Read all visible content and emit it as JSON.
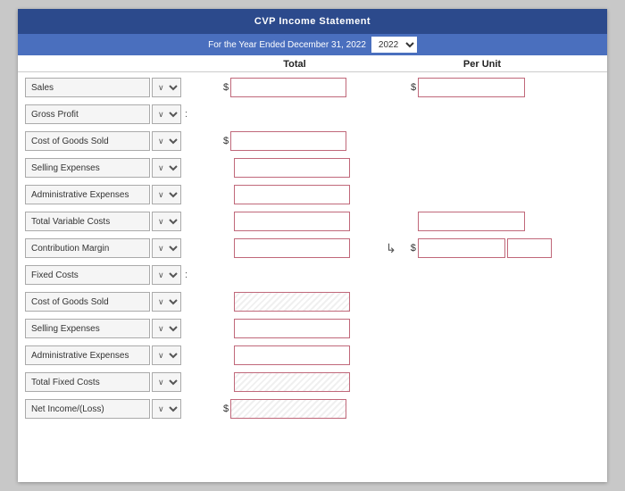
{
  "header": {
    "title": "CVP Income Statement",
    "subheader_label": "For the Year Ended December 31, 2022"
  },
  "columns": {
    "total": "Total",
    "per_unit": "Per Unit"
  },
  "rows": [
    {
      "id": "sales",
      "label": "Sales",
      "has_dropdown": true,
      "has_colon": false,
      "has_dollar_left": false,
      "has_dollar_total": true,
      "has_input_left": false,
      "has_input_total": true,
      "has_input_perunit": true,
      "has_dollar_perunit": true
    },
    {
      "id": "gross-profit",
      "label": "Gross Profit",
      "has_dropdown": true,
      "has_colon": true,
      "has_dollar_left": false,
      "has_dollar_total": false,
      "has_input_left": false,
      "has_input_total": false,
      "has_input_perunit": false,
      "has_dollar_perunit": false
    },
    {
      "id": "cost-of-goods-sold-1",
      "label": "Cost of Goods Sold",
      "has_dropdown": true,
      "has_colon": false,
      "has_dollar_left": true,
      "has_dollar_total": false,
      "has_input_left": true,
      "has_input_total": false,
      "has_input_perunit": false,
      "has_dollar_perunit": false
    },
    {
      "id": "selling-expenses-1",
      "label": "Selling Expenses",
      "has_dropdown": true,
      "has_colon": false,
      "has_dollar_left": false,
      "has_dollar_total": false,
      "has_input_left": true,
      "has_input_total": false,
      "has_input_perunit": false,
      "has_dollar_perunit": false
    },
    {
      "id": "admin-expenses-1",
      "label": "Administrative Expenses",
      "has_dropdown": true,
      "has_colon": false,
      "has_dollar_left": false,
      "has_dollar_total": false,
      "has_input_left": true,
      "has_input_total": false,
      "has_input_perunit": false,
      "has_dollar_perunit": false
    },
    {
      "id": "total-variable-costs",
      "label": "Total Variable Costs",
      "has_dropdown": true,
      "has_colon": false,
      "has_dollar_left": false,
      "has_dollar_total": false,
      "has_input_left": false,
      "has_input_total": true,
      "has_input_perunit": true,
      "has_dollar_perunit": false
    },
    {
      "id": "contribution-margin",
      "label": "Contribution Margin",
      "has_dropdown": true,
      "has_colon": false,
      "has_dollar_left": false,
      "has_dollar_total": false,
      "has_input_left": false,
      "has_input_total": true,
      "has_input_perunit": true,
      "has_dollar_perunit": true,
      "has_cursor": true
    },
    {
      "id": "fixed-costs",
      "label": "Fixed Costs",
      "has_dropdown": true,
      "has_colon": true,
      "has_dollar_left": false,
      "has_dollar_total": false,
      "has_input_left": false,
      "has_input_total": false,
      "has_input_perunit": false,
      "has_dollar_perunit": false
    },
    {
      "id": "cost-of-goods-sold-2",
      "label": "Cost of Goods Sold",
      "has_dropdown": true,
      "has_colon": false,
      "has_dollar_left": false,
      "has_dollar_total": false,
      "has_input_left": true,
      "has_input_total": false,
      "has_input_perunit": false,
      "has_dollar_perunit": false,
      "striped": true
    },
    {
      "id": "selling-expenses-2",
      "label": "Selling Expenses",
      "has_dropdown": true,
      "has_colon": false,
      "has_dollar_left": false,
      "has_dollar_total": false,
      "has_input_left": true,
      "has_input_total": false,
      "has_input_perunit": false,
      "has_dollar_perunit": false,
      "striped": false
    },
    {
      "id": "admin-expenses-2",
      "label": "Administrative Expenses",
      "has_dropdown": true,
      "has_colon": false,
      "has_dollar_left": false,
      "has_dollar_total": false,
      "has_input_left": true,
      "has_input_total": false,
      "has_input_perunit": false,
      "has_dollar_perunit": false,
      "striped": false
    },
    {
      "id": "total-fixed-costs",
      "label": "Total Fixed Costs",
      "has_dropdown": true,
      "has_colon": false,
      "has_dollar_left": false,
      "has_dollar_total": false,
      "has_input_left": false,
      "has_input_total": true,
      "has_input_perunit": false,
      "has_dollar_perunit": false
    },
    {
      "id": "net-income",
      "label": "Net Income/(Loss)",
      "has_dropdown": true,
      "has_colon": false,
      "has_dollar_left": false,
      "has_dollar_total": true,
      "has_input_left": false,
      "has_input_total": true,
      "has_input_perunit": false,
      "has_dollar_perunit": false,
      "striped_total": true
    }
  ],
  "symbols": {
    "dollar": "$",
    "dropdown_arrow": "∨",
    "cursor": "↳"
  }
}
